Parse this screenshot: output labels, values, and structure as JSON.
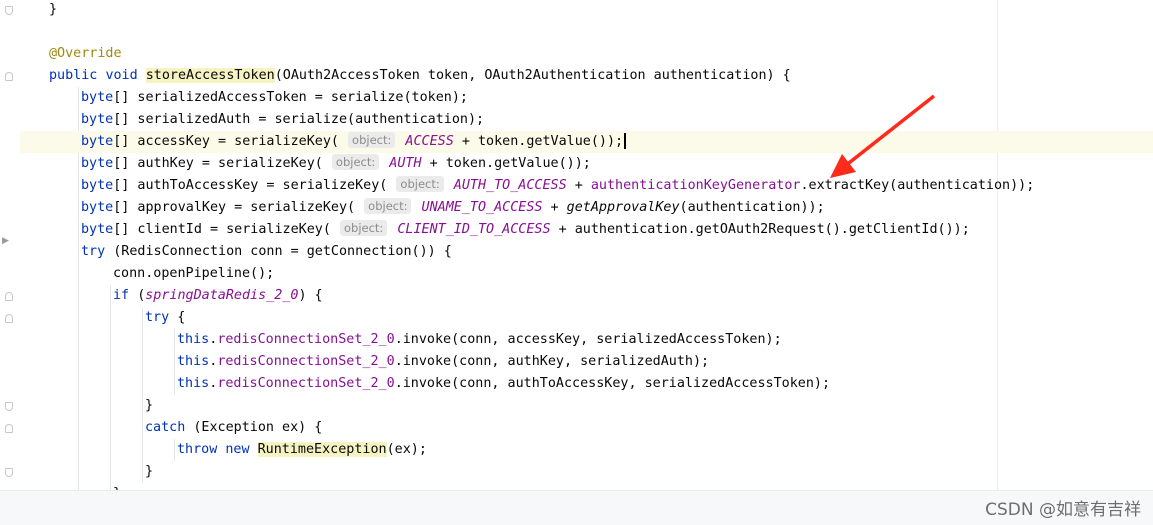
{
  "editor": {
    "lines": [
      {
        "indent": 0,
        "tokens": [
          [
            "p",
            "}"
          ]
        ]
      },
      {
        "indent": 0,
        "tokens": []
      },
      {
        "indent": 0,
        "tokens": [
          [
            "ann",
            "@Override"
          ]
        ]
      },
      {
        "indent": 0,
        "tokens": [
          [
            "kw",
            "public "
          ],
          [
            "kw",
            "void "
          ],
          [
            "hl",
            "storeAccessToken"
          ],
          [
            "p",
            "(OAuth2AccessToken token, OAuth2Authentication authentication) {"
          ]
        ]
      },
      {
        "indent": 1,
        "tokens": [
          [
            "kw",
            "byte"
          ],
          [
            "p",
            "[] serializedAccessToken = serialize(token);"
          ]
        ]
      },
      {
        "indent": 1,
        "tokens": [
          [
            "kw",
            "byte"
          ],
          [
            "p",
            "[] serializedAuth = serialize(authentication);"
          ]
        ]
      },
      {
        "indent": 1,
        "current": true,
        "caret": true,
        "tokens": [
          [
            "kw",
            "byte"
          ],
          [
            "p",
            "[] accessKey = serializeKey( "
          ],
          [
            "hint",
            "object:"
          ],
          [
            "stat",
            " ACCESS"
          ],
          [
            "p",
            " + token.getValue());"
          ]
        ]
      },
      {
        "indent": 1,
        "tokens": [
          [
            "kw",
            "byte"
          ],
          [
            "p",
            "[] authKey = serializeKey( "
          ],
          [
            "hint",
            "object:"
          ],
          [
            "stat",
            " AUTH"
          ],
          [
            "p",
            " + token.getValue());"
          ]
        ]
      },
      {
        "indent": 1,
        "tokens": [
          [
            "kw",
            "byte"
          ],
          [
            "p",
            "[] authToAccessKey = serializeKey( "
          ],
          [
            "hint",
            "object:"
          ],
          [
            "stat",
            " AUTH_TO_ACCESS"
          ],
          [
            "p",
            " + "
          ],
          [
            "fld",
            "authenticationKeyGenerator"
          ],
          [
            "p",
            ".extractKey(authentication));"
          ]
        ]
      },
      {
        "indent": 1,
        "tokens": [
          [
            "kw",
            "byte"
          ],
          [
            "p",
            "[] approvalKey = serializeKey( "
          ],
          [
            "hint",
            "object:"
          ],
          [
            "stat",
            " UNAME_TO_ACCESS"
          ],
          [
            "p",
            " + "
          ],
          [
            "smth",
            "getApprovalKey"
          ],
          [
            "p",
            "(authentication));"
          ]
        ]
      },
      {
        "indent": 1,
        "tokens": [
          [
            "kw",
            "byte"
          ],
          [
            "p",
            "[] clientId = serializeKey( "
          ],
          [
            "hint",
            "object:"
          ],
          [
            "stat",
            " CLIENT_ID_TO_ACCESS"
          ],
          [
            "p",
            " + authentication.getOAuth2Request().getClientId());"
          ]
        ]
      },
      {
        "indent": 1,
        "tokens": [
          [
            "kw",
            "try "
          ],
          [
            "p",
            "(RedisConnection conn = getConnection()) {"
          ]
        ]
      },
      {
        "indent": 2,
        "tokens": [
          [
            "p",
            "conn.openPipeline();"
          ]
        ]
      },
      {
        "indent": 2,
        "tokens": [
          [
            "kw",
            "if "
          ],
          [
            "p",
            "("
          ],
          [
            "stat",
            "springDataRedis_2_0"
          ],
          [
            "p",
            ") {"
          ]
        ]
      },
      {
        "indent": 3,
        "tokens": [
          [
            "kw",
            "try "
          ],
          [
            "p",
            "{"
          ]
        ]
      },
      {
        "indent": 4,
        "tokens": [
          [
            "kw",
            "this"
          ],
          [
            "p",
            "."
          ],
          [
            "fld",
            "redisConnectionSet_2_0"
          ],
          [
            "p",
            ".invoke(conn, accessKey, serializedAccessToken);"
          ]
        ]
      },
      {
        "indent": 4,
        "tokens": [
          [
            "kw",
            "this"
          ],
          [
            "p",
            "."
          ],
          [
            "fld",
            "redisConnectionSet_2_0"
          ],
          [
            "p",
            ".invoke(conn, authKey, serializedAuth);"
          ]
        ]
      },
      {
        "indent": 4,
        "tokens": [
          [
            "kw",
            "this"
          ],
          [
            "p",
            "."
          ],
          [
            "fld",
            "redisConnectionSet_2_0"
          ],
          [
            "p",
            ".invoke(conn, authToAccessKey, serializedAccessToken);"
          ]
        ]
      },
      {
        "indent": 3,
        "tokens": [
          [
            "p",
            "}"
          ]
        ]
      },
      {
        "indent": 3,
        "tokens": [
          [
            "kw",
            "catch "
          ],
          [
            "p",
            "(Exception ex) {"
          ]
        ]
      },
      {
        "indent": 4,
        "tokens": [
          [
            "kw",
            "throw "
          ],
          [
            "kw",
            "new "
          ],
          [
            "hl",
            "RuntimeException"
          ],
          [
            "p",
            "(ex);"
          ]
        ]
      },
      {
        "indent": 3,
        "tokens": [
          [
            "p",
            "}"
          ]
        ]
      },
      {
        "indent": 2,
        "tokens": [
          [
            "p",
            "}"
          ]
        ]
      }
    ]
  },
  "watermark": "CSDN @如意有吉祥",
  "colors": {
    "keyword": "#0033b3",
    "field": "#871094",
    "annotation": "#9e880d",
    "arrow": "#ff2a1a"
  }
}
